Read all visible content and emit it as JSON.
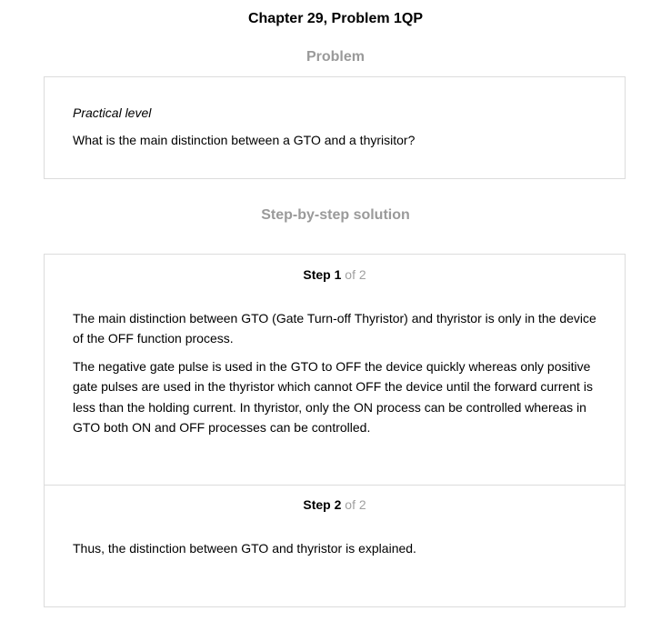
{
  "page": {
    "title": "Chapter 29, Problem 1QP"
  },
  "problem": {
    "heading": "Problem",
    "level": "Practical level",
    "question": "What is the main distinction between a GTO and a thyrisitor?"
  },
  "solution": {
    "heading": "Step-by-step solution",
    "steps": [
      {
        "label": "Step",
        "number": "1",
        "of_text": "of 2",
        "paragraphs": [
          "The main distinction between GTO (Gate Turn-off Thyristor) and thyristor is only in the device of the OFF function process.",
          "The negative gate pulse is used in the GTO to OFF the device quickly whereas only positive gate pulses are used in the thyristor which cannot OFF the device until the forward current is less than the holding current. In thyristor, only the ON process can be controlled whereas in GTO both ON and OFF processes can be controlled."
        ]
      },
      {
        "label": "Step",
        "number": "2",
        "of_text": "of 2",
        "paragraphs": [
          "Thus, the distinction between GTO and thyristor is explained."
        ]
      }
    ]
  }
}
